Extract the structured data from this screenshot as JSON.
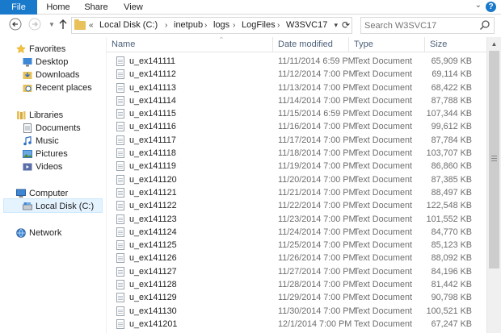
{
  "ribbon": {
    "tabs": [
      "File",
      "Home",
      "Share",
      "View"
    ],
    "help": "?"
  },
  "address": {
    "overflow": "«",
    "crumbs": [
      "Local Disk (C:)",
      "inetpub",
      "logs",
      "LogFiles",
      "W3SVC17"
    ]
  },
  "search": {
    "placeholder": "Search W3SVC17"
  },
  "nav": {
    "favorites": "Favorites",
    "desktop": "Desktop",
    "downloads": "Downloads",
    "recent": "Recent places",
    "libraries": "Libraries",
    "documents": "Documents",
    "music": "Music",
    "pictures": "Pictures",
    "videos": "Videos",
    "computer": "Computer",
    "local_disk": "Local Disk (C:)",
    "network": "Network"
  },
  "columns": {
    "name": "Name",
    "date": "Date modified",
    "type": "Type",
    "size": "Size"
  },
  "files": [
    {
      "name": "u_ex141111",
      "date": "11/11/2014 6:59 PM",
      "type": "Text Document",
      "size": "65,909 KB"
    },
    {
      "name": "u_ex141112",
      "date": "11/12/2014 7:00 PM",
      "type": "Text Document",
      "size": "69,114 KB"
    },
    {
      "name": "u_ex141113",
      "date": "11/13/2014 7:00 PM",
      "type": "Text Document",
      "size": "68,422 KB"
    },
    {
      "name": "u_ex141114",
      "date": "11/14/2014 7:00 PM",
      "type": "Text Document",
      "size": "87,788 KB"
    },
    {
      "name": "u_ex141115",
      "date": "11/15/2014 6:59 PM",
      "type": "Text Document",
      "size": "107,344 KB"
    },
    {
      "name": "u_ex141116",
      "date": "11/16/2014 7:00 PM",
      "type": "Text Document",
      "size": "99,612 KB"
    },
    {
      "name": "u_ex141117",
      "date": "11/17/2014 7:00 PM",
      "type": "Text Document",
      "size": "87,784 KB"
    },
    {
      "name": "u_ex141118",
      "date": "11/18/2014 7:00 PM",
      "type": "Text Document",
      "size": "103,707 KB"
    },
    {
      "name": "u_ex141119",
      "date": "11/19/2014 7:00 PM",
      "type": "Text Document",
      "size": "86,860 KB"
    },
    {
      "name": "u_ex141120",
      "date": "11/20/2014 7:00 PM",
      "type": "Text Document",
      "size": "87,385 KB"
    },
    {
      "name": "u_ex141121",
      "date": "11/21/2014 7:00 PM",
      "type": "Text Document",
      "size": "88,497 KB"
    },
    {
      "name": "u_ex141122",
      "date": "11/22/2014 7:00 PM",
      "type": "Text Document",
      "size": "122,548 KB"
    },
    {
      "name": "u_ex141123",
      "date": "11/23/2014 7:00 PM",
      "type": "Text Document",
      "size": "101,552 KB"
    },
    {
      "name": "u_ex141124",
      "date": "11/24/2014 7:00 PM",
      "type": "Text Document",
      "size": "84,770 KB"
    },
    {
      "name": "u_ex141125",
      "date": "11/25/2014 7:00 PM",
      "type": "Text Document",
      "size": "85,123 KB"
    },
    {
      "name": "u_ex141126",
      "date": "11/26/2014 7:00 PM",
      "type": "Text Document",
      "size": "88,092 KB"
    },
    {
      "name": "u_ex141127",
      "date": "11/27/2014 7:00 PM",
      "type": "Text Document",
      "size": "84,196 KB"
    },
    {
      "name": "u_ex141128",
      "date": "11/28/2014 7:00 PM",
      "type": "Text Document",
      "size": "81,442 KB"
    },
    {
      "name": "u_ex141129",
      "date": "11/29/2014 7:00 PM",
      "type": "Text Document",
      "size": "90,798 KB"
    },
    {
      "name": "u_ex141130",
      "date": "11/30/2014 7:00 PM",
      "type": "Text Document",
      "size": "100,521 KB"
    },
    {
      "name": "u_ex141201",
      "date": "12/1/2014 7:00 PM",
      "type": "Text Document",
      "size": "67,247 KB"
    }
  ],
  "colors": {
    "accent": "#1979ca",
    "folder": "#e8c15a",
    "selection": "#e5f3ff"
  }
}
